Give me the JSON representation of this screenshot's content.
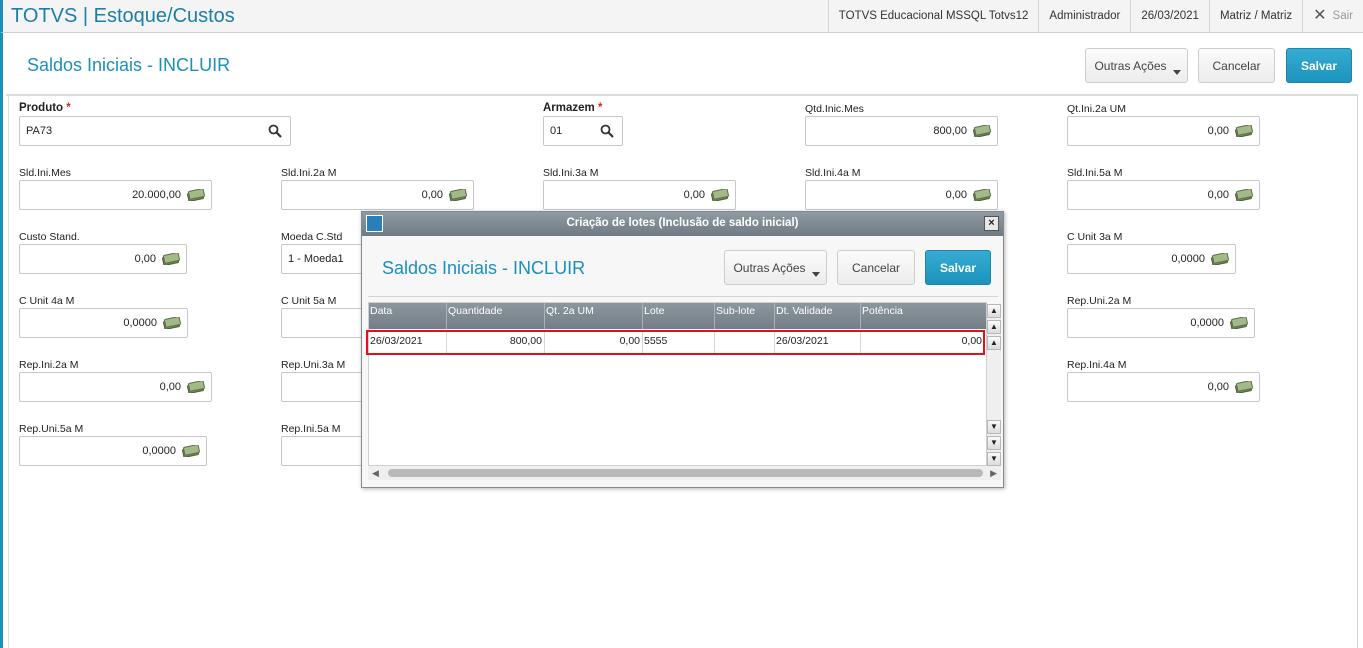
{
  "topbar": {
    "app_title": "TOTVS | Estoque/Custos",
    "environment": "TOTVS Educacional MSSQL Totvs12",
    "user": "Administrador",
    "date": "26/03/2021",
    "branch": "Matriz / Matriz",
    "exit_label": "Sair"
  },
  "page": {
    "title": "Saldos Iniciais - INCLUIR",
    "other_actions_label": "Outras Ações",
    "cancel_label": "Cancelar",
    "save_label": "Salvar"
  },
  "fields": {
    "produto": {
      "label": "Produto",
      "required": "*",
      "value": "PA73"
    },
    "armazem": {
      "label": "Armazem",
      "required": "*",
      "value": "01"
    },
    "qtd_inic_mes": {
      "label": "Qtd.Inic.Mes",
      "value": "800,00"
    },
    "qt_ini_2a_um": {
      "label": "Qt.Ini.2a UM",
      "value": "0,00"
    },
    "sld_ini_mes": {
      "label": "Sld.Ini.Mes",
      "value": "20.000,00"
    },
    "sld_ini_2a_m": {
      "label": "Sld.Ini.2a M",
      "value": "0,00"
    },
    "sld_ini_3a_m": {
      "label": "Sld.Ini.3a M",
      "value": "0,00"
    },
    "sld_ini_4a_m": {
      "label": "Sld.Ini.4a M",
      "value": "0,00"
    },
    "sld_ini_5a_m": {
      "label": "Sld.Ini.5a M",
      "value": "0,00"
    },
    "custo_stand": {
      "label": "Custo Stand.",
      "value": "0,00"
    },
    "moeda_c_std": {
      "label": "Moeda C.Std",
      "value": "1 - Moeda1"
    },
    "c_unit_3a_m": {
      "label": "C Unit 3a M",
      "value": "0,0000"
    },
    "c_unit_4a_m": {
      "label": "C Unit 4a M",
      "value": "0,0000"
    },
    "c_unit_5a_m": {
      "label": "C Unit 5a M",
      "value": ""
    },
    "rep_uni_2a_m": {
      "label": "Rep.Uni.2a M",
      "value": "0,0000"
    },
    "rep_ini_2a_m": {
      "label": "Rep.Ini.2a M",
      "value": "0,00"
    },
    "rep_uni_3a_m": {
      "label": "Rep.Uni.3a M",
      "value": ""
    },
    "rep_ini_4a_m": {
      "label": "Rep.Ini.4a M",
      "value": "0,00"
    },
    "rep_uni_5a_m": {
      "label": "Rep.Uni.5a M",
      "value": "0,0000"
    },
    "rep_ini_5a_m": {
      "label": "Rep.Ini.5a M",
      "value": ""
    }
  },
  "modal": {
    "window_title": "Criação de lotes (Inclusão de saldo inicial)",
    "close_glyph": "×",
    "title": "Saldos Iniciais - INCLUIR",
    "other_actions_label": "Outras Ações",
    "cancel_label": "Cancelar",
    "save_label": "Salvar",
    "columns": [
      "Data",
      "Quantidade",
      "Qt. 2a UM",
      "Lote",
      "Sub-lote",
      "Dt. Validade",
      "Potência"
    ],
    "rows": [
      [
        "26/03/2021",
        "800,00",
        "0,00",
        "5555",
        "",
        "26/03/2021",
        "0,00"
      ]
    ],
    "highlight_color": "#e0101c"
  },
  "icons": {
    "field_action": "money-icon",
    "lookup": "search-icon",
    "scroll_top": "double-up-arrow-icon",
    "scroll_up": "up-arrow-icon",
    "scroll_down": "down-arrow-icon",
    "scroll_bottom": "double-down-arrow-icon"
  },
  "colors": {
    "accent": "#1b8fbf",
    "primary_button": "#1c93bd",
    "grid_header": "#7f8a92"
  }
}
